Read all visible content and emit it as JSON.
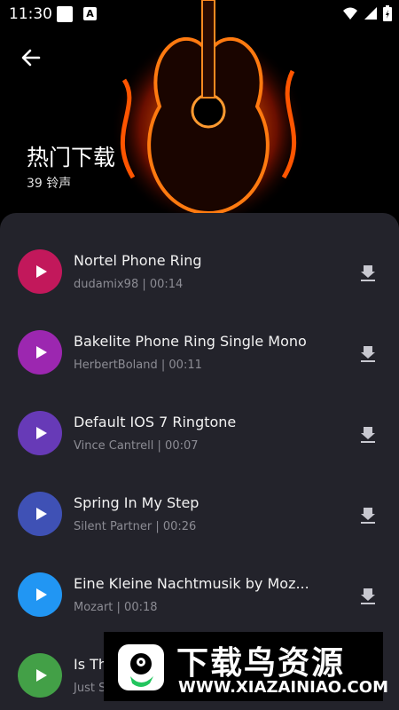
{
  "status": {
    "time": "11:30",
    "app_icon_letter": "A"
  },
  "header": {
    "title": "热门下载",
    "subtitle": "39 铃声"
  },
  "ringtones": [
    {
      "name": "Nortel Phone Ring",
      "meta": "dudamix98 | 00:14",
      "color": "#c2185b"
    },
    {
      "name": "Bakelite Phone Ring Single Mono",
      "meta": "HerbertBoland | 00:11",
      "color": "#9c27b0"
    },
    {
      "name": "Default IOS 7 Ringtone",
      "meta": "Vince Cantrell | 00:07",
      "color": "#673ab7"
    },
    {
      "name": "Spring In My Step",
      "meta": "Silent Partner | 00:26",
      "color": "#3f51b5"
    },
    {
      "name": "Eine Kleine Nachtmusik by Moz...",
      "meta": "Mozart | 00:18",
      "color": "#2196f3"
    },
    {
      "name": "Is Th",
      "meta": "Just S",
      "color": "#43a047"
    }
  ],
  "watermark": {
    "brand": "下载鸟资源",
    "url": "WWW.XIAZAINIAO.COM"
  }
}
